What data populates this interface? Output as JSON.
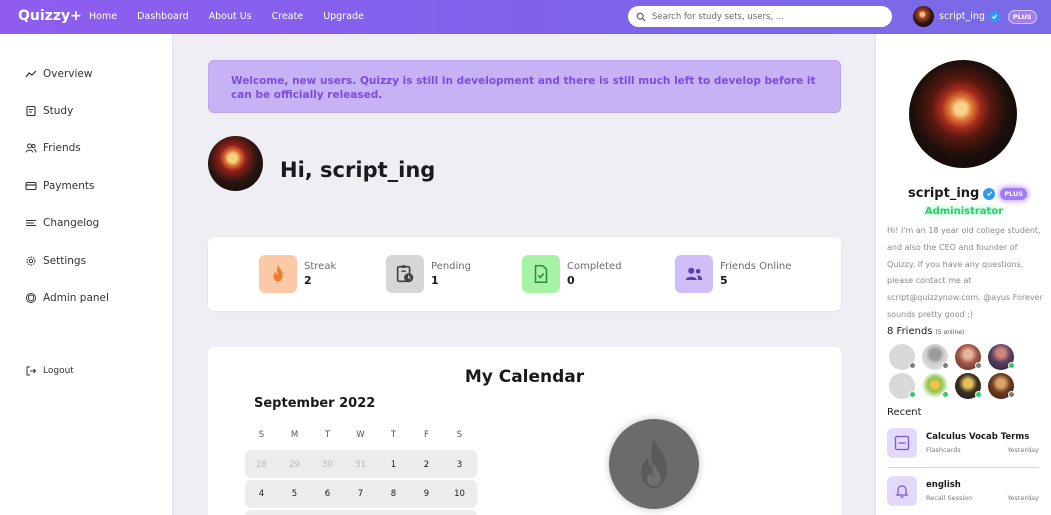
{
  "brand": "Quizzy+",
  "nav": [
    "Home",
    "Dashboard",
    "About Us",
    "Create",
    "Upgrade"
  ],
  "search": {
    "placeholder": "Search for study sets, users, ..."
  },
  "user": {
    "name": "script_ing",
    "badge": "PLUS"
  },
  "sidebar": {
    "items": [
      {
        "label": "Overview",
        "icon": "trend-icon"
      },
      {
        "label": "Study",
        "icon": "document-icon"
      },
      {
        "label": "Friends",
        "icon": "users-icon"
      },
      {
        "label": "Payments",
        "icon": "credit-card-icon"
      },
      {
        "label": "Changelog",
        "icon": "list-icon"
      },
      {
        "label": "Settings",
        "icon": "gear-icon"
      },
      {
        "label": "Admin panel",
        "icon": "shield-icon"
      }
    ],
    "logout": "Logout"
  },
  "banner": "Welcome, new users. Quizzy is still in development and there is still much left to develop before it can be officially released.",
  "greeting": "Hi, script_ing",
  "stats": [
    {
      "label": "Streak",
      "value": "2",
      "color": "#fbc9a6",
      "icon": "flame-icon"
    },
    {
      "label": "Pending",
      "value": "1",
      "color": "#d6d6d6",
      "icon": "clipboard-clock-icon"
    },
    {
      "label": "Completed",
      "value": "0",
      "color": "#a7f3a6",
      "icon": "file-check-icon"
    },
    {
      "label": "Friends Online",
      "value": "5",
      "color": "#d1bdf8",
      "icon": "users-icon"
    }
  ],
  "calendar": {
    "title": "My Calendar",
    "month": "September 2022",
    "weekdays": [
      "S",
      "M",
      "T",
      "W",
      "T",
      "F",
      "S"
    ],
    "weeks": [
      [
        "28",
        "29",
        "30",
        "31",
        "1",
        "2",
        "3"
      ],
      [
        "4",
        "5",
        "6",
        "7",
        "8",
        "9",
        "10"
      ]
    ]
  },
  "profile": {
    "name": "script_ing",
    "badge": "PLUS",
    "role": "Administrator",
    "bio": "Hi! I'm an 18 year old college student, and also the CEO and founder of Quizzy. If you have any questions, please contact me at script@quizzynow.com. @ayus Forever sounds pretty good ;)",
    "friends_label": "8 Friends",
    "friends_online": "(5 online)",
    "recent_label": "Recent",
    "recent": [
      {
        "title": "Calculus Vocab Terms",
        "type": "Flashcards",
        "date": "Yesterday",
        "icon": "flashcards-icon"
      },
      {
        "title": "english",
        "type": "Recall Session",
        "date": "Yesterday",
        "icon": "bell-icon"
      }
    ]
  },
  "colors": {
    "accent": "#8e5df0",
    "online": "#2ecc71",
    "offline": "#7d7d7d"
  }
}
